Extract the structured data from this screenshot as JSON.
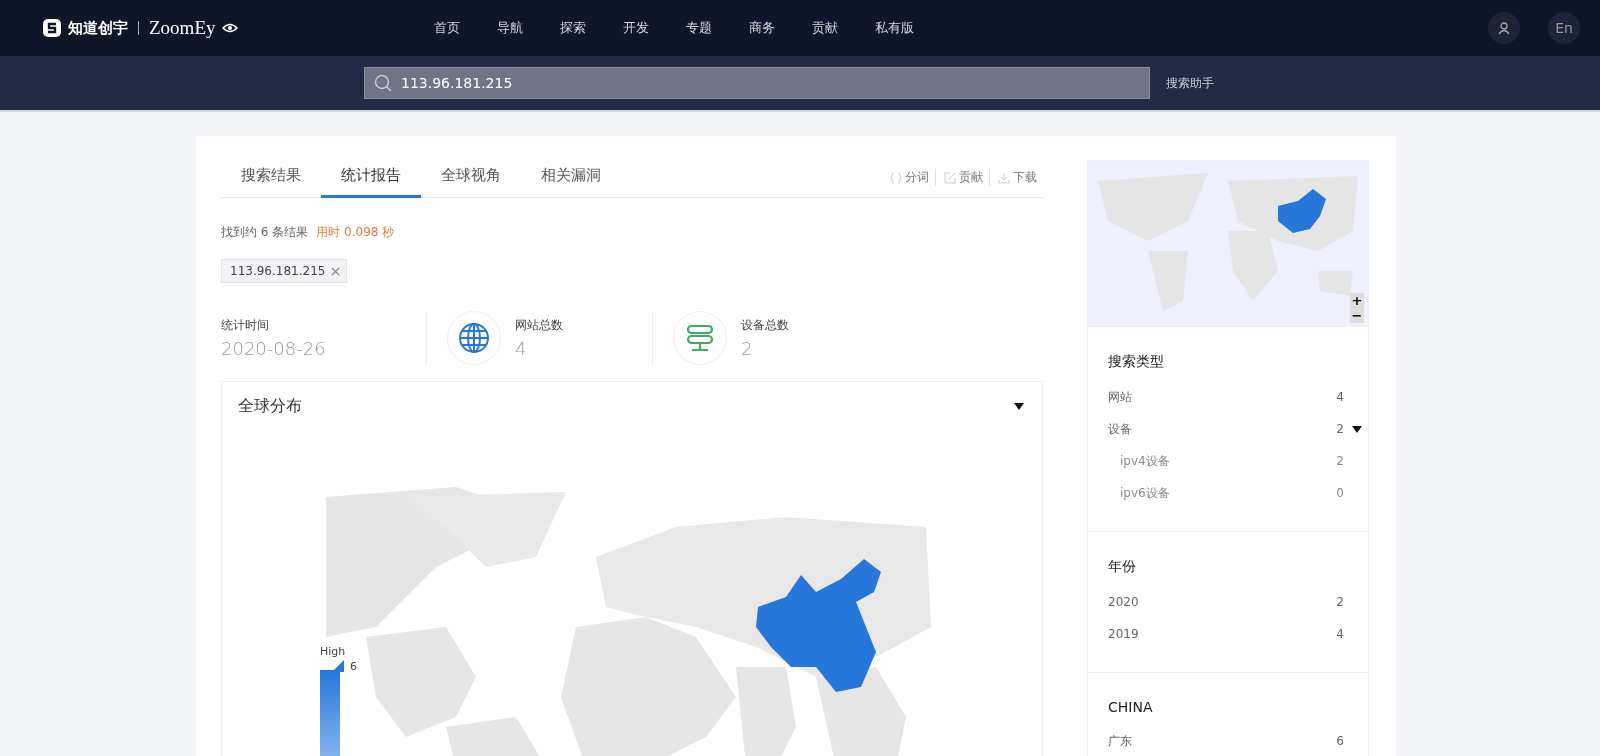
{
  "header": {
    "logo": "知道创宇",
    "brand": "ZoomEy",
    "nav": [
      "首页",
      "导航",
      "探索",
      "开发",
      "专题",
      "商务",
      "贡献",
      "私有版"
    ],
    "language": "En"
  },
  "search": {
    "value": "113.96.181.215",
    "helper": "搜索助手"
  },
  "tabs": [
    {
      "label": "搜索结果",
      "selected": false
    },
    {
      "label": "统计报告",
      "selected": true
    },
    {
      "label": "全球视角",
      "selected": false
    },
    {
      "label": "相关漏洞",
      "selected": false
    }
  ],
  "actions": [
    {
      "label": "分词",
      "kind": "braces"
    },
    {
      "label": "贡献",
      "kind": "edit"
    },
    {
      "label": "下载",
      "kind": "download"
    }
  ],
  "summary": {
    "count": "找到约 6 条结果",
    "timing": "用时 0.098 秒"
  },
  "filter_tag": "113.96.181.215",
  "stats": [
    {
      "label": "统计时间",
      "value": "2020-08-26",
      "kind": "date"
    },
    {
      "label": "网站总数",
      "value": "4",
      "kind": "globe"
    },
    {
      "label": "设备总数",
      "value": "2",
      "kind": "server"
    }
  ],
  "panel": {
    "title": "全球分布",
    "legend_label": "High",
    "legend_value": "6"
  },
  "minimap": {
    "zoom_in": "+",
    "zoom_out": "−"
  },
  "sidebar": [
    {
      "title": "搜索类型",
      "items": [
        {
          "label": "网站",
          "count": "4"
        },
        {
          "label": "设备",
          "count": "2",
          "expanded": true,
          "children": [
            {
              "label": "ipv4设备",
              "count": "2"
            },
            {
              "label": "ipv6设备",
              "count": "0"
            }
          ]
        }
      ]
    },
    {
      "title": "年份",
      "items": [
        {
          "label": "2020",
          "count": "2"
        },
        {
          "label": "2019",
          "count": "4"
        }
      ]
    },
    {
      "title": "CHINA",
      "items": [
        {
          "label": "广东",
          "count": "6"
        }
      ]
    }
  ]
}
